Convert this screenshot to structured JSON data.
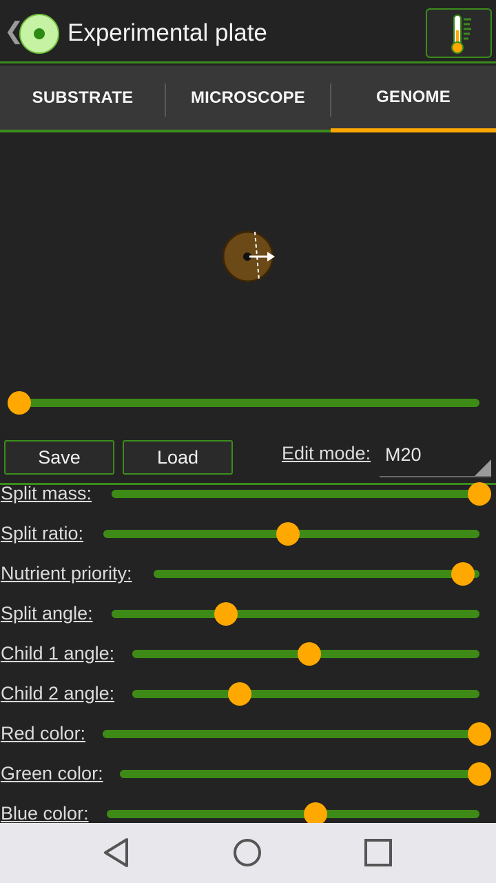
{
  "app": {
    "title": "Experimental plate"
  },
  "tabs": [
    {
      "label": "SUBSTRATE",
      "active": false
    },
    {
      "label": "MICROSCOPE",
      "active": false
    },
    {
      "label": "GENOME",
      "active": true
    }
  ],
  "preview": {
    "timeline_position": 0.0
  },
  "actions": {
    "save_label": "Save",
    "load_label": "Load",
    "edit_mode_label": "Edit mode:",
    "edit_mode_value": "M20"
  },
  "params": [
    {
      "label": "Split mass:",
      "value": 1.0
    },
    {
      "label": "Split ratio:",
      "value": 0.49
    },
    {
      "label": "Nutrient priority:",
      "value": 0.95
    },
    {
      "label": "Split angle:",
      "value": 0.31
    },
    {
      "label": "Child 1 angle:",
      "value": 0.51
    },
    {
      "label": "Child 2 angle:",
      "value": 0.31
    },
    {
      "label": "Red color:",
      "value": 1.0
    },
    {
      "label": "Green color:",
      "value": 1.0
    },
    {
      "label": "Blue color:",
      "value": 0.56
    }
  ],
  "colors": {
    "accent": "#ffa800",
    "brand_green": "#3c8c1c",
    "cell_fill": "#6b4a17"
  },
  "icons": {
    "back": "chevron-left-icon",
    "logo": "petri-dish-icon",
    "thermometer": "thermometer-icon",
    "nav_back": "triangle-back-icon",
    "nav_home": "circle-home-icon",
    "nav_recents": "square-recents-icon"
  }
}
